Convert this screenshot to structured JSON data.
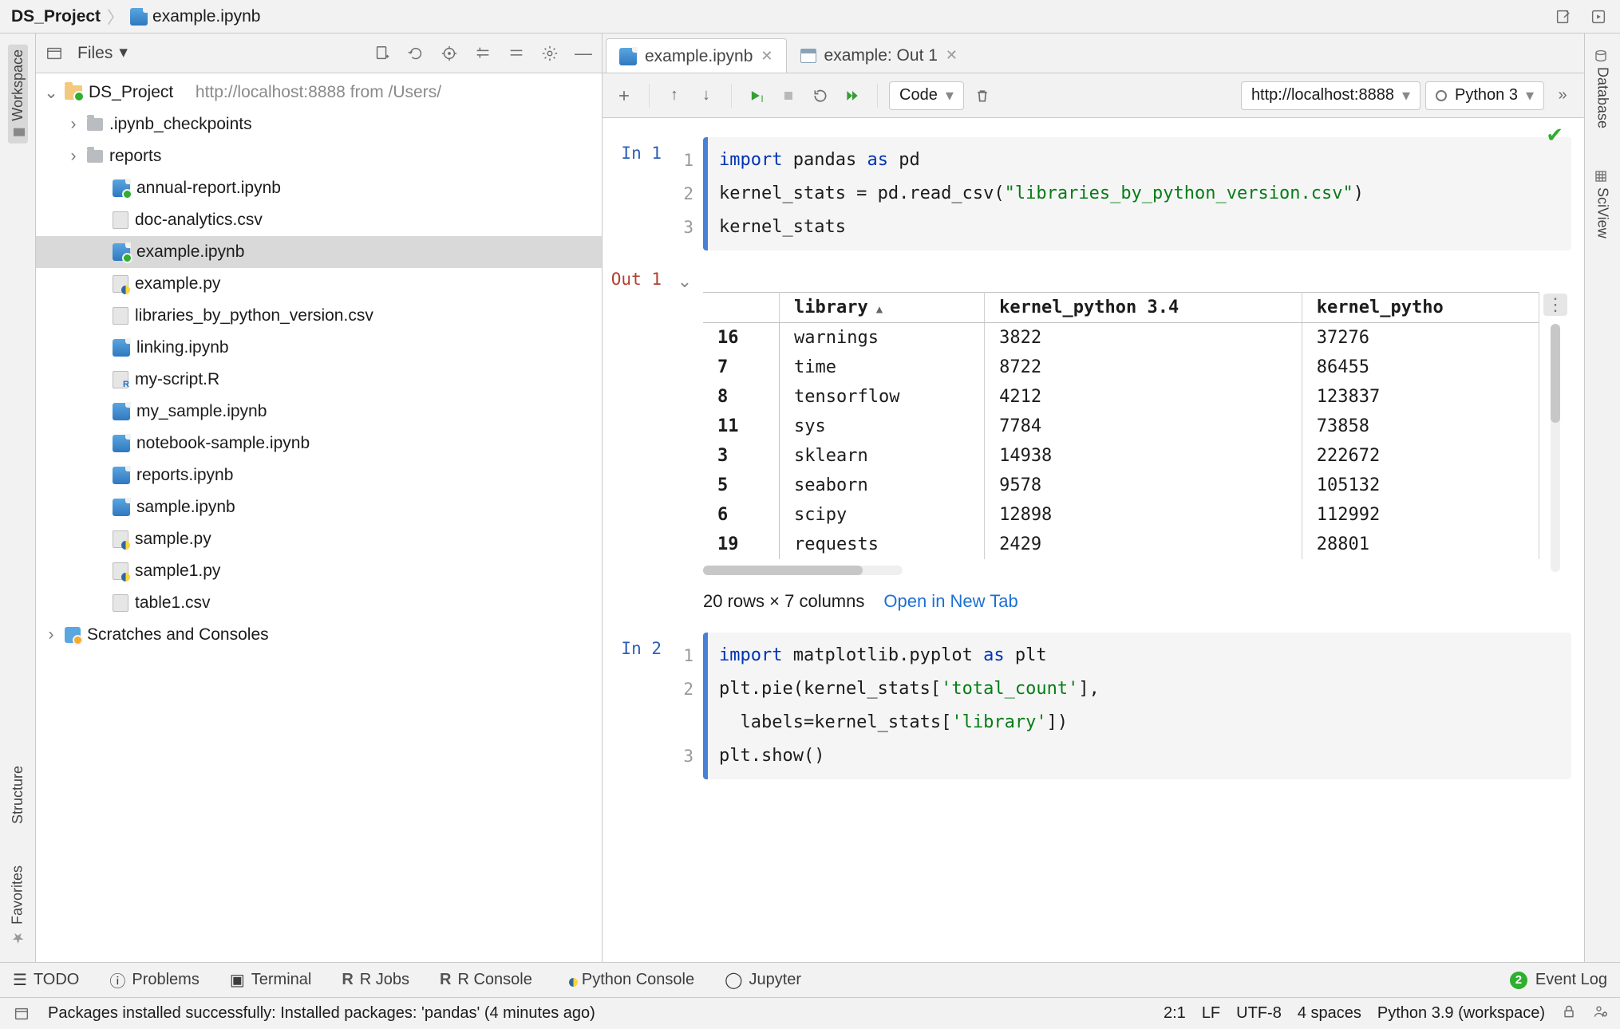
{
  "breadcrumb": {
    "project": "DS_Project",
    "file": "example.ipynb"
  },
  "left_strip": {
    "workspace": "Workspace",
    "structure": "Structure",
    "favorites": "Favorites"
  },
  "right_strip": {
    "database": "Database",
    "sciview": "SciView"
  },
  "project_pane": {
    "selector": "Files",
    "root": {
      "name": "DS_Project",
      "hint": "http://localhost:8888 from /Users/"
    },
    "children": [
      {
        "type": "folder",
        "name": ".ipynb_checkpoints",
        "expandable": true
      },
      {
        "type": "folder",
        "name": "reports",
        "expandable": true
      },
      {
        "type": "ipynb",
        "name": "annual-report.ipynb"
      },
      {
        "type": "csv",
        "name": "doc-analytics.csv"
      },
      {
        "type": "ipynb",
        "name": "example.ipynb",
        "selected": true
      },
      {
        "type": "py",
        "name": "example.py"
      },
      {
        "type": "csv",
        "name": "libraries_by_python_version.csv"
      },
      {
        "type": "ipynb-plain",
        "name": "linking.ipynb"
      },
      {
        "type": "r",
        "name": "my-script.R"
      },
      {
        "type": "ipynb-plain",
        "name": "my_sample.ipynb"
      },
      {
        "type": "ipynb-plain",
        "name": "notebook-sample.ipynb"
      },
      {
        "type": "ipynb-plain",
        "name": "reports.ipynb"
      },
      {
        "type": "ipynb-plain",
        "name": "sample.ipynb"
      },
      {
        "type": "py",
        "name": "sample.py"
      },
      {
        "type": "py",
        "name": "sample1.py"
      },
      {
        "type": "csv",
        "name": "table1.csv"
      }
    ],
    "scratches": "Scratches and Consoles"
  },
  "editor_tabs": [
    {
      "kind": "ipynb",
      "label": "example.ipynb",
      "active": true
    },
    {
      "kind": "table",
      "label": "example: Out 1",
      "active": false
    }
  ],
  "nb_toolbar": {
    "cell_type": "Code",
    "server": "http://localhost:8888",
    "kernel": "Python 3"
  },
  "cells": {
    "in1": {
      "prompt": "In 1",
      "lines": [
        "1",
        "2",
        "3"
      ],
      "code_html": "<span class='kw'>import</span> pandas <span class='kw'>as</span> pd\nkernel_stats = pd.read_csv(<span class='str'>\"libraries_by_python_version.csv\"</span>)\nkernel_stats"
    },
    "out1": {
      "prompt": "Out 1",
      "open_in_tab": "Open in New Tab",
      "shape": "20 rows × 7 columns",
      "columns": [
        "",
        "library",
        "kernel_python 3.4",
        "kernel_pytho"
      ],
      "rows": [
        [
          "16",
          "warnings",
          "3822",
          "37276"
        ],
        [
          "7",
          "time",
          "8722",
          "86455"
        ],
        [
          "8",
          "tensorflow",
          "4212",
          "123837"
        ],
        [
          "11",
          "sys",
          "7784",
          "73858"
        ],
        [
          "3",
          "sklearn",
          "14938",
          "222672"
        ],
        [
          "5",
          "seaborn",
          "9578",
          "105132"
        ],
        [
          "6",
          "scipy",
          "12898",
          "112992"
        ],
        [
          "19",
          "requests",
          "2429",
          "28801"
        ]
      ]
    },
    "in2": {
      "prompt": "In 2",
      "lines": [
        "1",
        "2",
        "",
        "3"
      ],
      "code_html": "<span class='kw'>import</span> matplotlib.pyplot <span class='kw'>as</span> plt\nplt.pie(kernel_stats[<span class='str'>'total_count'</span>],\n  labels=kernel_stats[<span class='str'>'library'</span>])\nplt.show()"
    }
  },
  "bottom_tabs": {
    "todo": "TODO",
    "problems": "Problems",
    "terminal": "Terminal",
    "r_jobs": "R Jobs",
    "r_console": "R Console",
    "py_console": "Python Console",
    "jupyter": "Jupyter",
    "event_log": "Event Log",
    "event_badge": "2"
  },
  "status_bar": {
    "message": "Packages installed successfully: Installed packages: 'pandas' (4 minutes ago)",
    "caret": "2:1",
    "eol": "LF",
    "encoding": "UTF-8",
    "indent": "4 spaces",
    "interpreter": "Python 3.9 (workspace)"
  }
}
